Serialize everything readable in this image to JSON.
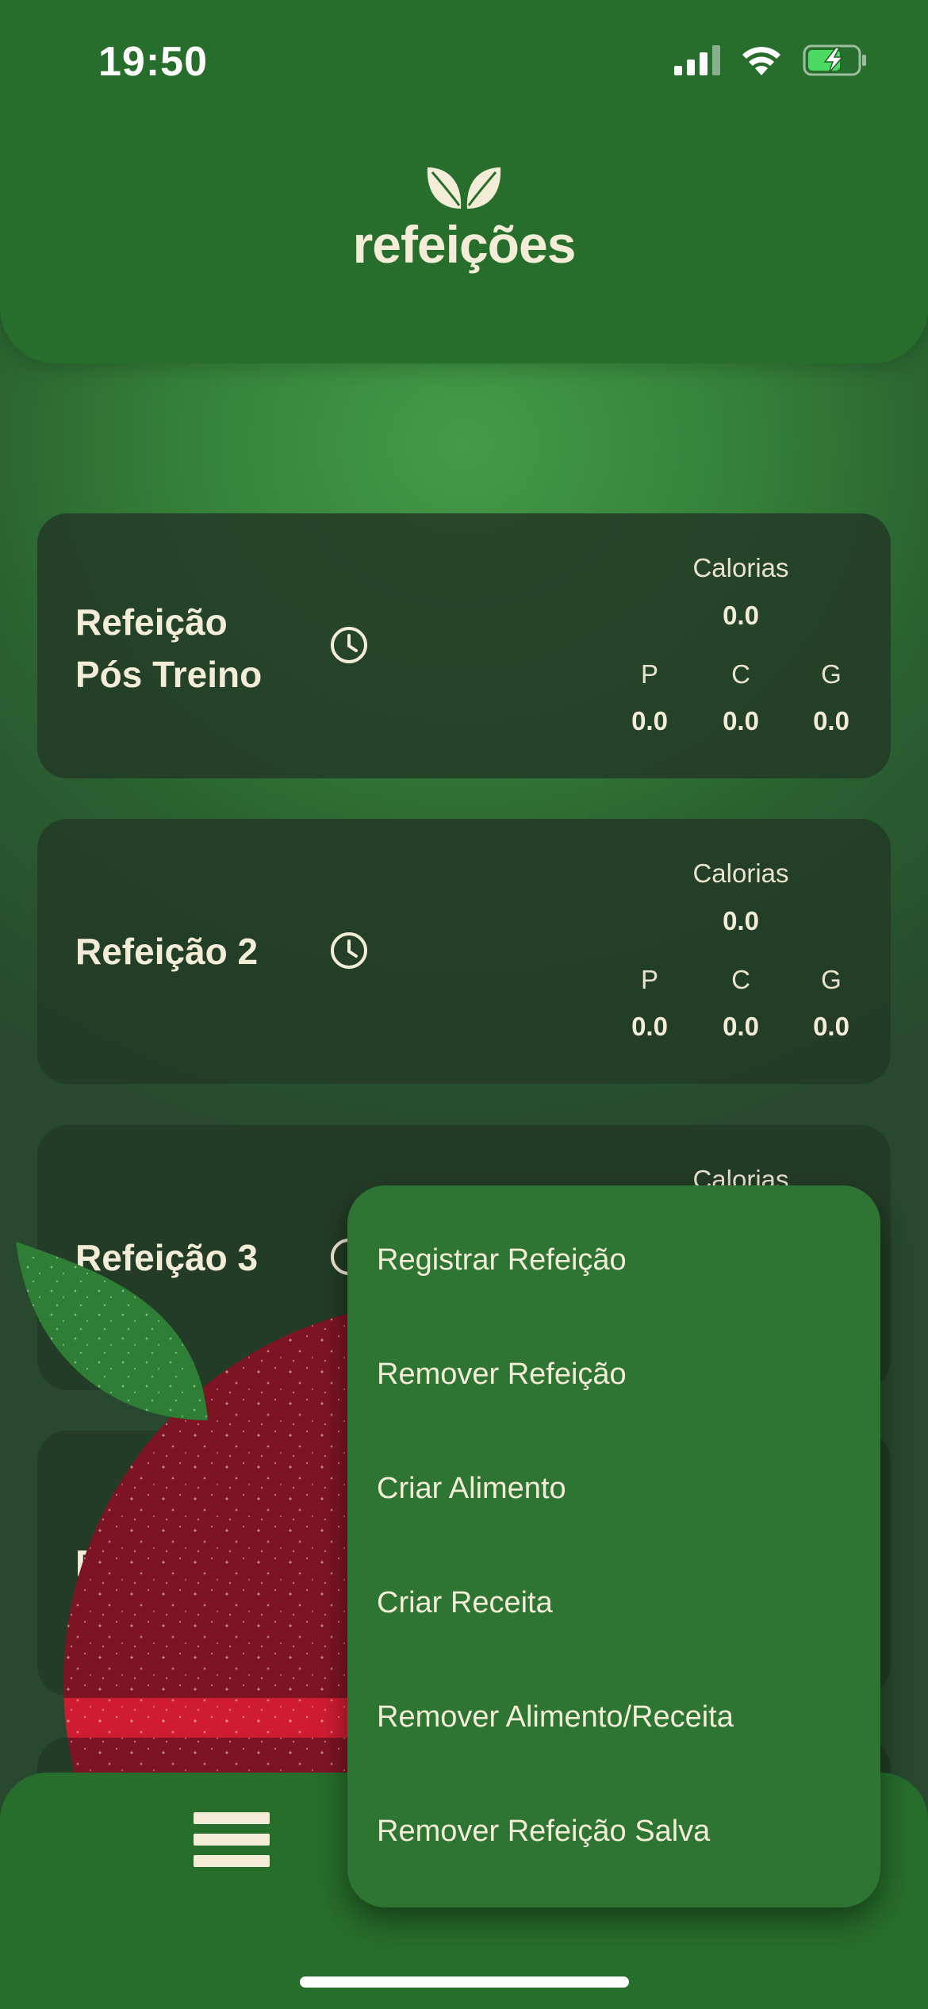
{
  "status_bar": {
    "time": "19:50"
  },
  "header": {
    "app_name": "refeições"
  },
  "meals": [
    {
      "title_line1": "Refeição",
      "title_line2": "Pós Treino",
      "calories_label": "Calorias",
      "calories": "0.0",
      "p_label": "P",
      "c_label": "C",
      "g_label": "G",
      "p": "0.0",
      "c": "0.0",
      "g": "0.0"
    },
    {
      "title_line1": "Refeição 2",
      "title_line2": "",
      "calories_label": "Calorias",
      "calories": "0.0",
      "p_label": "P",
      "c_label": "C",
      "g_label": "G",
      "p": "0.0",
      "c": "0.0",
      "g": "0.0"
    },
    {
      "title_line1": "Refeição 3",
      "title_line2": "",
      "calories_label": "Calorias"
    },
    {
      "title_line1": "Refeição 4",
      "title_line2": ""
    }
  ],
  "menu": {
    "items": [
      "Registrar Refeição",
      "Remover Refeição",
      "Criar Alimento",
      "Criar Receita",
      "Remover Alimento/Receita",
      "Remover Refeição Salva"
    ]
  },
  "icons": {
    "logo": "leaves-icon",
    "clock": "clock-icon",
    "menu": "hamburger-menu-icon",
    "signal": "cellular-signal-icon",
    "wifi": "wifi-icon",
    "battery": "battery-charging-icon"
  },
  "colors": {
    "header_green": "#276e2c",
    "menu_green": "#2e7433",
    "card_bg": "#233a26",
    "text_cream": "#f3ecd6",
    "battery_green": "#4cd964"
  }
}
